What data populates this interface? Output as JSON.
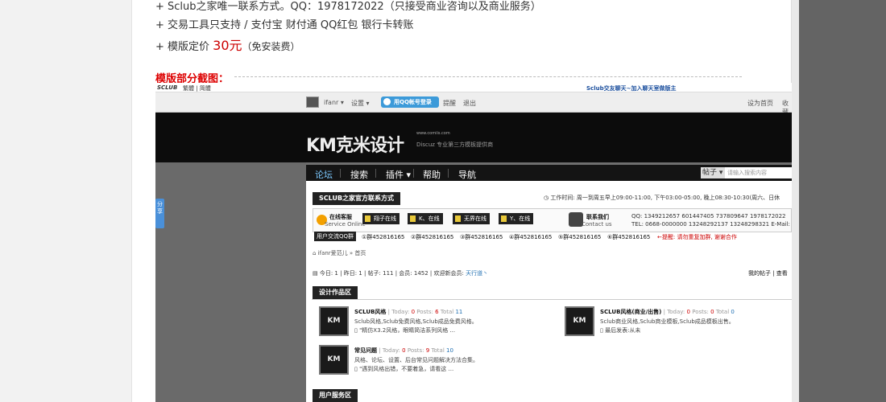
{
  "info": {
    "line1": "+ Sclub之家唯一联系方式。QQ：1978172022（只接受商业咨询以及商业服务）",
    "line2": "+ 交易工具只支持 / 支付宝 财付通 QQ红包 银行卡转账",
    "line3_prefix": "+ 模版定价 ",
    "price": "30元",
    "line3_suffix": "（免安装费）"
  },
  "screenshot_heading": "模版部分截图：",
  "side_tab": "分享",
  "shot": {
    "top_logo": "SCLUB",
    "top_links": "繁體 | 简體",
    "top_right": "Sclub交友聊天~加入聊天室做版主",
    "toolbar": {
      "user": "ifanr",
      "settings": "设置",
      "qq_login": "用QQ帐号登录",
      "remind": "提醒",
      "logout": "退出",
      "set_home": "设为首页",
      "favorite": "收藏"
    },
    "logo": "KM克米设计",
    "logo_small": "www.comiis.com",
    "logo_sub": "Discuz 专业第三方模板提供商",
    "nav": [
      "论坛",
      "搜索",
      "插件",
      "帮助",
      "导航"
    ],
    "search_select": "帖子",
    "search_placeholder": "请输入搜索内容",
    "contact_panel_title": "SCLUB之家官方联系方式",
    "work_time": "工作时间: 周一到周五早上09:00-11:00, 下午03:00-05:00, 晚上08:30-10:30(周六、日休",
    "online_service": "在线客服",
    "service_online": "Service Online",
    "service_buttons": [
      "翔子在线",
      "K、在线",
      "无界在线",
      "Y、在线"
    ],
    "contact_us": "联系我们",
    "contact_us_en": "Contact us",
    "qq_numbers": "QQ: 1349212657  601447405  737809647  1978172022",
    "tel": "TEL: 0668-0000000 13248292137 13248298321 E-Mail:",
    "qq_groups_label": "用户交流QQ群",
    "qq_groups": [
      "①群452816165",
      "②群452816165",
      "③群452816165",
      "④群452816165",
      "⑤群452816165",
      "⑥群452816165"
    ],
    "qq_warning": "←提醒: 请勿重复加群, 谢谢合作",
    "breadcrumb": "ifanr爱范儿 » 首页",
    "stats": "今日: 1 | 昨日: 1 | 帖子: 111 | 会员: 1452 | 欢迎新会员:",
    "new_member": "天行道丶",
    "my_posts": "我的帖子 | 查看",
    "section1": "设计作品区",
    "section2": "用户服务区",
    "forums": [
      {
        "icon": "KM",
        "name": "SCLUB风格",
        "today": "0",
        "posts": "6",
        "total": "11",
        "desc": "Sclub风格,Sclub免费风格,Sclub成品免费风格。",
        "last": "\"精仿X3.2风格，眼睛简洁系列风格 ..."
      },
      {
        "icon": "KM",
        "name": "SCLUB风格(商业/出售)",
        "today": "0",
        "posts": "0",
        "total": "0",
        "desc": "Sclub商业风格,Sclub商业模板,Sclub成品模板出售。",
        "last": "最后发表:从未"
      },
      {
        "icon": "KM",
        "name": "常见问题",
        "today": "0",
        "posts": "9",
        "total": "10",
        "desc": "风格、论坛、设置、后台常见问题解决方法合集。",
        "last": "\"遇到风格出错，不要着急，请看这 ..."
      }
    ],
    "today_label": "Today:",
    "posts_label": "Posts:",
    "total_label": "Total"
  }
}
